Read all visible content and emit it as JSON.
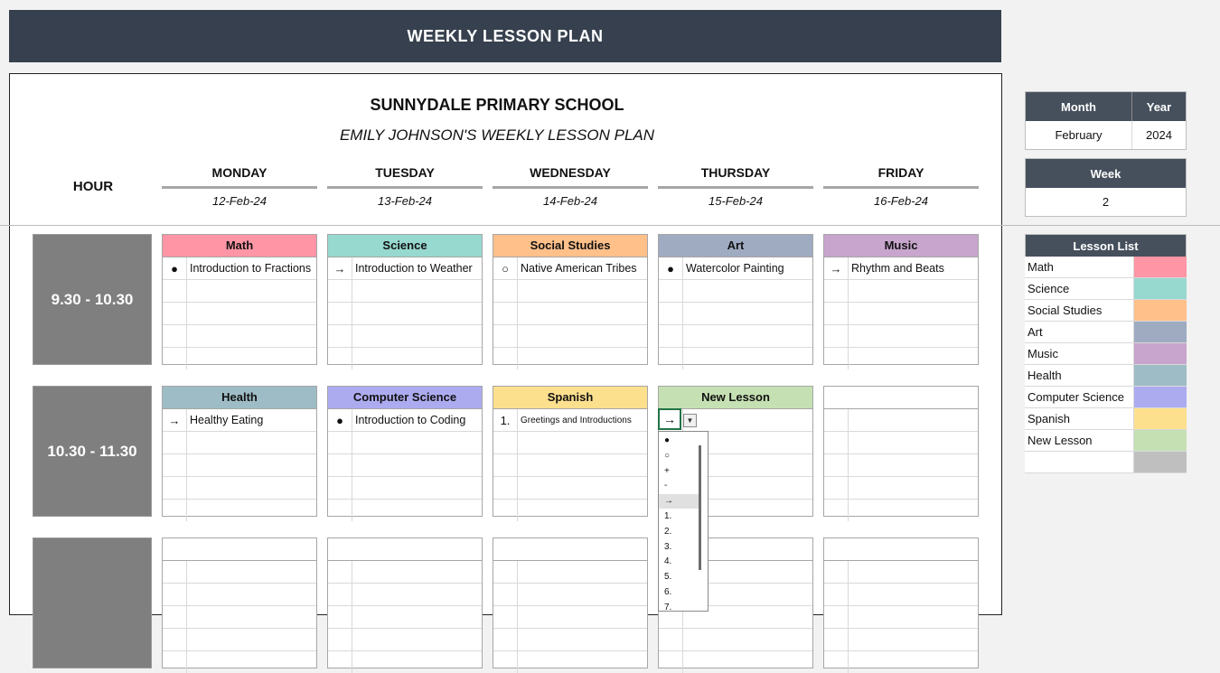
{
  "header": {
    "title": "WEEKLY LESSON PLAN"
  },
  "plan": {
    "school": "SUNNYDALE PRIMARY SCHOOL",
    "teacher": "EMILY JOHNSON'S WEEKLY LESSON PLAN",
    "hour_label": "HOUR",
    "days": [
      {
        "name": "MONDAY",
        "date": "12-Feb-24"
      },
      {
        "name": "TUESDAY",
        "date": "13-Feb-24"
      },
      {
        "name": "WEDNESDAY",
        "date": "14-Feb-24"
      },
      {
        "name": "THURSDAY",
        "date": "15-Feb-24"
      },
      {
        "name": "FRIDAY",
        "date": "16-Feb-24"
      }
    ],
    "slots": [
      {
        "hour": "9.30 - 10.30",
        "lessons": [
          {
            "subject": "Math",
            "color": "#ff95a5",
            "bullet": "●",
            "text": "Introduction to Fractions"
          },
          {
            "subject": "Science",
            "color": "#97d8cf",
            "bullet": "→",
            "text": "Introduction to Weather"
          },
          {
            "subject": "Social Studies",
            "color": "#ffc08a",
            "bullet": "○",
            "text": "Native American Tribes"
          },
          {
            "subject": "Art",
            "color": "#9eabc1",
            "bullet": "●",
            "text": "Watercolor Painting"
          },
          {
            "subject": "Music",
            "color": "#c7a5cc",
            "bullet": "→",
            "text": "Rhythm and Beats"
          }
        ]
      },
      {
        "hour": "10.30 - 11.30",
        "lessons": [
          {
            "subject": "Health",
            "color": "#9ebcc5",
            "bullet": "→",
            "text": "Healthy Eating"
          },
          {
            "subject": "Computer Science",
            "color": "#adabf0",
            "bullet": "●",
            "text": "Introduction to Coding"
          },
          {
            "subject": "Spanish",
            "color": "#fde08e",
            "bullet": "1.",
            "text": "Greetings and Introductions"
          },
          {
            "subject": "New Lesson",
            "color": "#c5e0b3",
            "bullet": "→",
            "text": ""
          },
          {
            "subject": "",
            "color": "#ffffff",
            "bullet": "",
            "text": ""
          }
        ]
      },
      {
        "hour": "",
        "lessons": [
          {
            "subject": "",
            "color": "#ffffff",
            "bullet": "",
            "text": ""
          },
          {
            "subject": "",
            "color": "#ffffff",
            "bullet": "",
            "text": ""
          },
          {
            "subject": "",
            "color": "#ffffff",
            "bullet": "",
            "text": ""
          },
          {
            "subject": "",
            "color": "#ffffff",
            "bullet": "",
            "text": ""
          },
          {
            "subject": "",
            "color": "#ffffff",
            "bullet": "",
            "text": ""
          }
        ]
      }
    ]
  },
  "side": {
    "month_label": "Month",
    "year_label": "Year",
    "month": "February",
    "year": "2024",
    "week_label": "Week",
    "week": "2",
    "lesson_list_title": "Lesson List",
    "lesson_list": [
      {
        "name": "Math",
        "color": "#ff95a5"
      },
      {
        "name": "Science",
        "color": "#97d8cf"
      },
      {
        "name": "Social Studies",
        "color": "#ffc08a"
      },
      {
        "name": "Art",
        "color": "#9eabc1"
      },
      {
        "name": "Music",
        "color": "#c7a5cc"
      },
      {
        "name": "Health",
        "color": "#9ebcc5"
      },
      {
        "name": "Computer Science",
        "color": "#adabf0"
      },
      {
        "name": "Spanish",
        "color": "#fde08e"
      },
      {
        "name": "New Lesson",
        "color": "#c5e0b3"
      },
      {
        "name": "",
        "color": "#bfbfbf"
      }
    ]
  },
  "dropdown": {
    "selected_value": "→",
    "options": [
      "●",
      "○",
      "+",
      "-",
      "→",
      "1.",
      "2.",
      "3.",
      "4.",
      "5.",
      "6.",
      "7."
    ],
    "selected_index": 4
  }
}
